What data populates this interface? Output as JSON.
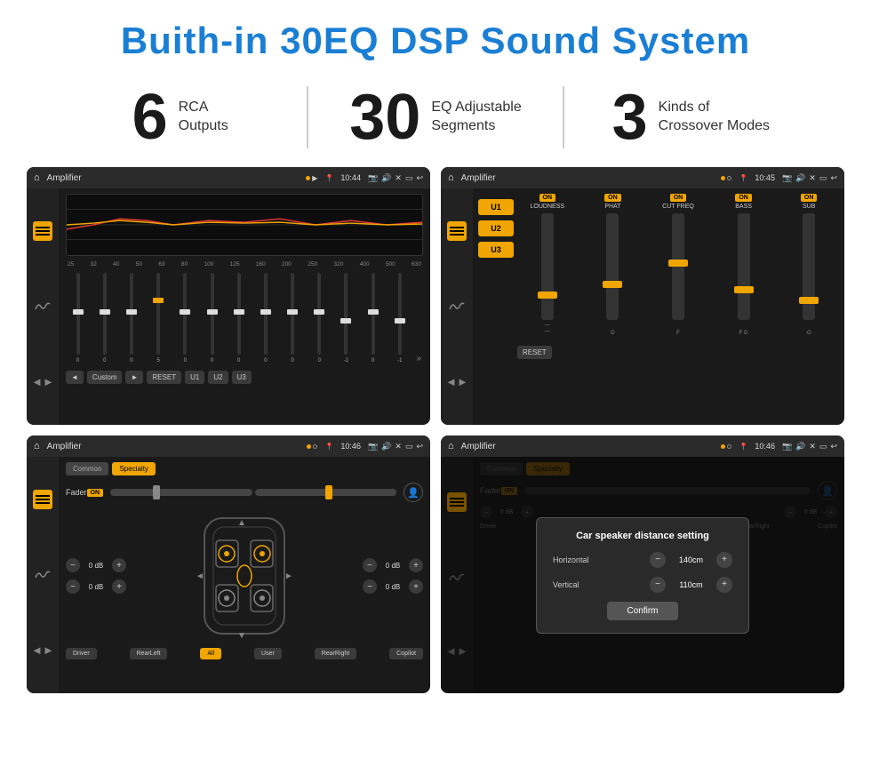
{
  "page": {
    "title": "Buith-in 30EQ DSP Sound System",
    "stats": [
      {
        "number": "6",
        "label": "RCA\nOutputs"
      },
      {
        "number": "30",
        "label": "EQ Adjustable\nSegments"
      },
      {
        "number": "3",
        "label": "Kinds of\nCrossover Modes"
      }
    ]
  },
  "screens": {
    "screen1": {
      "topbar": {
        "title": "Amplifier",
        "time": "10:44"
      },
      "freq_labels": [
        "25",
        "32",
        "40",
        "50",
        "63",
        "80",
        "100",
        "125",
        "160",
        "200",
        "250",
        "320",
        "400",
        "500",
        "630"
      ],
      "slider_values": [
        "0",
        "0",
        "0",
        "5",
        "0",
        "0",
        "0",
        "0",
        "0",
        "0",
        "-1",
        "0",
        "-1"
      ],
      "buttons": [
        "Custom",
        "RESET",
        "U1",
        "U2",
        "U3"
      ]
    },
    "screen2": {
      "topbar": {
        "title": "Amplifier",
        "time": "10:45"
      },
      "u_buttons": [
        "U1",
        "U2",
        "U3"
      ],
      "channels": [
        {
          "label": "LOUDNESS",
          "on": true
        },
        {
          "label": "PHAT",
          "on": true
        },
        {
          "label": "CUT FREQ",
          "on": true
        },
        {
          "label": "BASS",
          "on": true
        },
        {
          "label": "SUB",
          "on": true
        }
      ],
      "reset_btn": "RESET"
    },
    "screen3": {
      "topbar": {
        "title": "Amplifier",
        "time": "10:46"
      },
      "tabs": [
        "Common",
        "Specialty"
      ],
      "active_tab": "Specialty",
      "fader_label": "Fader",
      "fader_on": "ON",
      "db_values": [
        "0 dB",
        "0 dB",
        "0 dB",
        "0 dB"
      ],
      "bottom_buttons": [
        "Driver",
        "RearLeft",
        "All",
        "User",
        "RearRight",
        "Copilot"
      ],
      "all_active": true
    },
    "screen4": {
      "topbar": {
        "title": "Amplifier",
        "time": "10:46"
      },
      "tabs": [
        "Common",
        "Specialty"
      ],
      "active_tab": "Specialty",
      "dialog": {
        "title": "Car speaker distance setting",
        "horizontal_label": "Horizontal",
        "horizontal_value": "140cm",
        "vertical_label": "Vertical",
        "vertical_value": "110cm",
        "confirm_btn": "Confirm"
      },
      "bottom_buttons": [
        "Driver",
        "RearLeft",
        "All",
        "User",
        "RearRight",
        "Copilot"
      ],
      "db_values": [
        "0 dB",
        "0 dB"
      ]
    }
  }
}
